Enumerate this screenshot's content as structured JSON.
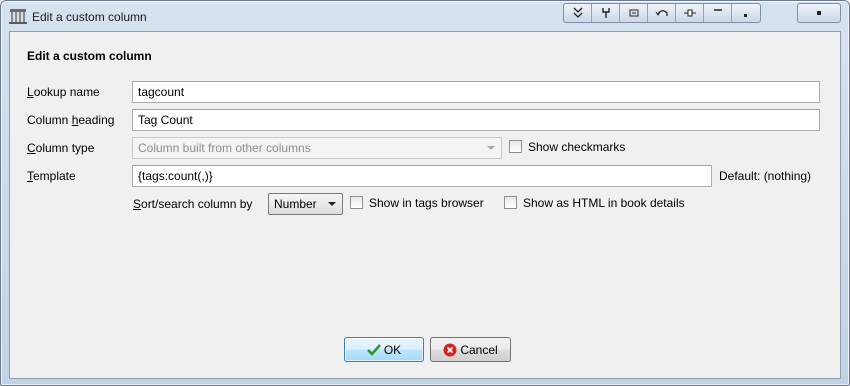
{
  "window": {
    "title": "Edit a custom column"
  },
  "titlebar_icons": [
    "collapse-icon",
    "pin-icon",
    "minimize-to-box-icon",
    "undo-icon",
    "toggle-icon",
    "minimize-icon",
    "restore-icon"
  ],
  "form": {
    "heading": "Edit a custom column",
    "lookup_name": {
      "label_pre": "",
      "label_key": "L",
      "label_post": "ookup name",
      "value": "tagcount"
    },
    "column_heading": {
      "label_pre": "Column ",
      "label_key": "h",
      "label_post": "eading",
      "value": "Tag Count"
    },
    "column_type": {
      "label_pre": "",
      "label_key": "C",
      "label_post": "olumn type",
      "value": "Column built from other columns",
      "show_checkmarks": "Show checkmarks"
    },
    "template": {
      "label_pre": "",
      "label_key": "T",
      "label_post": "emplate",
      "value": "{tags:count(,)}",
      "default_text": "Default: (nothing)"
    },
    "sort_search": {
      "label_pre": "",
      "label_key": "S",
      "label_post": "ort/search column by",
      "value": "Number"
    },
    "show_in_tags_browser": "Show in tags browser",
    "show_as_html": "Show as HTML in book details"
  },
  "buttons": {
    "ok": "OK",
    "cancel": "Cancel"
  },
  "colors": {
    "ok_check": "#2e9a2e",
    "cancel_red": "#d6241d"
  }
}
